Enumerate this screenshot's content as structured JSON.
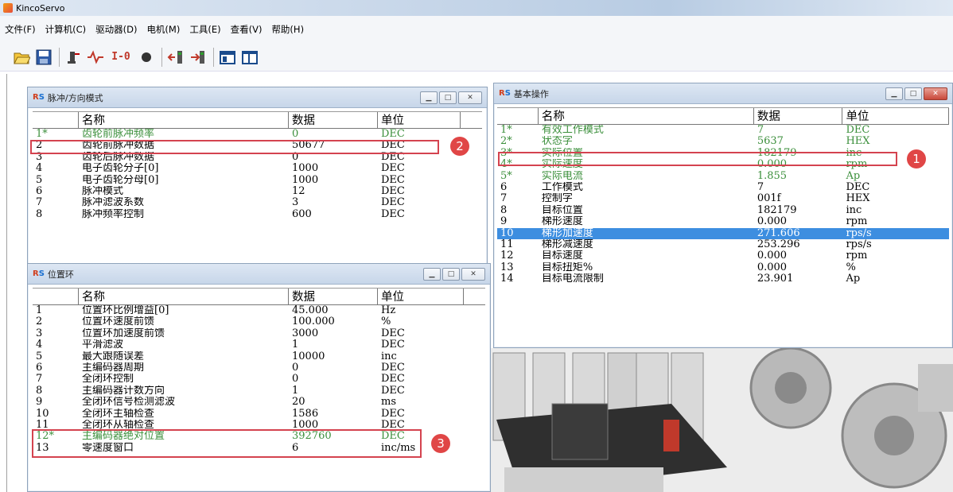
{
  "app": {
    "title": "KincoServo"
  },
  "menu": [
    "文件(F)",
    "计算机(C)",
    "驱动器(D)",
    "电机(M)",
    "工具(E)",
    "查看(V)",
    "帮助(H)"
  ],
  "toolbar": {
    "buttons": [
      "open-folder-icon",
      "save-icon",
      "hand-icon",
      "waveform-icon",
      "io-icon",
      "record-icon",
      "upload-icon",
      "download-icon",
      "panel-icon",
      "frame-icon"
    ],
    "io_text": "I-0"
  },
  "pulse_window": {
    "title": "脉冲/方向模式",
    "headers": [
      "名称",
      "数据",
      "单位"
    ],
    "rows": [
      {
        "no": "1*",
        "name": "齿轮前脉冲频率",
        "data": "0",
        "unit": "DEC"
      },
      {
        "no": "2",
        "name": "齿轮前脉冲数据",
        "data": "50677",
        "unit": "DEC"
      },
      {
        "no": "3",
        "name": "齿轮后脉冲数据",
        "data": "0",
        "unit": "DEC"
      },
      {
        "no": "4",
        "name": "电子齿轮分子[0]",
        "data": "1000",
        "unit": "DEC"
      },
      {
        "no": "5",
        "name": "电子齿轮分母[0]",
        "data": "1000",
        "unit": "DEC"
      },
      {
        "no": "6",
        "name": "脉冲模式",
        "data": "12",
        "unit": "DEC"
      },
      {
        "no": "7",
        "name": "脉冲滤波系数",
        "data": "3",
        "unit": "DEC"
      },
      {
        "no": "8",
        "name": "脉冲频率控制",
        "data": "600",
        "unit": "DEC"
      }
    ],
    "badge": "2"
  },
  "position_window": {
    "title": "位置环",
    "headers": [
      "名称",
      "数据",
      "单位"
    ],
    "rows": [
      {
        "no": "1",
        "name": "位置环比例增益[0]",
        "data": "45.000",
        "unit": "Hz"
      },
      {
        "no": "2",
        "name": "位置环速度前馈",
        "data": "100.000",
        "unit": "%"
      },
      {
        "no": "3",
        "name": "位置环加速度前馈",
        "data": "3000",
        "unit": "DEC"
      },
      {
        "no": "4",
        "name": "平滑滤波",
        "data": "1",
        "unit": "DEC"
      },
      {
        "no": "5",
        "name": "最大跟随误差",
        "data": "10000",
        "unit": "inc"
      },
      {
        "no": "6",
        "name": "主编码器周期",
        "data": "0",
        "unit": "DEC"
      },
      {
        "no": "7",
        "name": "全闭环控制",
        "data": "0",
        "unit": "DEC"
      },
      {
        "no": "8",
        "name": "主编码器计数方向",
        "data": "1",
        "unit": "DEC"
      },
      {
        "no": "9",
        "name": "全闭环信号检测滤波",
        "data": "20",
        "unit": "ms"
      },
      {
        "no": "10",
        "name": "全闭环主轴检查",
        "data": "1586",
        "unit": "DEC"
      },
      {
        "no": "11",
        "name": "全闭环从轴检查",
        "data": "1000",
        "unit": "DEC"
      },
      {
        "no": "12*",
        "name": "主编码器绝对位置",
        "data": "392760",
        "unit": "DEC"
      },
      {
        "no": "13",
        "name": "零速度窗口",
        "data": "6",
        "unit": "inc/ms"
      }
    ],
    "badge": "3"
  },
  "basic_window": {
    "title": "基本操作",
    "headers": [
      "名称",
      "数据",
      "单位"
    ],
    "rows": [
      {
        "no": "1*",
        "name": "有效工作模式",
        "data": "7",
        "unit": "DEC"
      },
      {
        "no": "2*",
        "name": "状态字",
        "data": "5637",
        "unit": "HEX"
      },
      {
        "no": "3*",
        "name": "实际位置",
        "data": "182179",
        "unit": "inc"
      },
      {
        "no": "4*",
        "name": "实际速度",
        "data": "0.000",
        "unit": "rpm"
      },
      {
        "no": "5*",
        "name": "实际电流",
        "data": "1.855",
        "unit": "Ap"
      },
      {
        "no": "6",
        "name": "工作模式",
        "data": "7",
        "unit": "DEC"
      },
      {
        "no": "7",
        "name": "控制字",
        "data": "001f",
        "unit": "HEX"
      },
      {
        "no": "8",
        "name": "目标位置",
        "data": "182179",
        "unit": "inc"
      },
      {
        "no": "9",
        "name": "梯形速度",
        "data": "0.000",
        "unit": "rpm"
      },
      {
        "no": "10",
        "name": "梯形加速度",
        "data": "271.606",
        "unit": "rps/s"
      },
      {
        "no": "11",
        "name": "梯形减速度",
        "data": "253.296",
        "unit": "rps/s"
      },
      {
        "no": "12",
        "name": "目标速度",
        "data": "0.000",
        "unit": "rpm"
      },
      {
        "no": "13",
        "name": "目标扭矩%",
        "data": "0.000",
        "unit": "%"
      },
      {
        "no": "14",
        "name": "目标电流限制",
        "data": "23.901",
        "unit": "Ap"
      }
    ],
    "badge": "1"
  },
  "colors": {
    "highlight_red": "#d4434f",
    "selected_row": "#3d8ee0",
    "status_green": "#3b8f3b"
  }
}
